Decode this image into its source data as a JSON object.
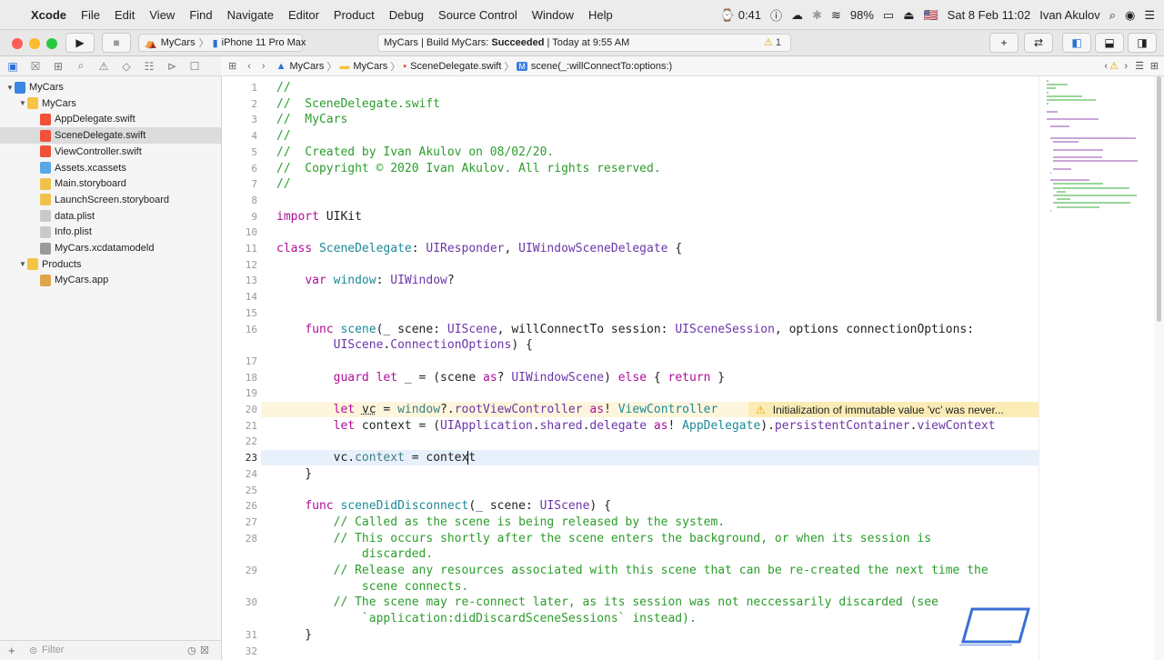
{
  "menubar": {
    "apple": "",
    "app_name": "Xcode",
    "items": [
      "File",
      "Edit",
      "View",
      "Find",
      "Navigate",
      "Editor",
      "Product",
      "Debug",
      "Source Control",
      "Window",
      "Help"
    ],
    "right": {
      "battery_time": "0:41",
      "battery_pct": "98%",
      "flag": "🇺🇸",
      "datetime": "Sat 8 Feb  11:02",
      "user": "Ivan Akulov"
    }
  },
  "toolbar": {
    "scheme": "MyCars",
    "device": "iPhone 11 Pro Max",
    "status_project": "MyCars | Build MyCars: ",
    "status_result": "Succeeded",
    "status_time": " | Today at 9:55 AM",
    "warning_count": "1"
  },
  "sidebar": {
    "items": [
      {
        "label": "MyCars",
        "indent": 0,
        "tri": "▼",
        "icon": "project",
        "color": "#3b86e0"
      },
      {
        "label": "MyCars",
        "indent": 1,
        "tri": "▼",
        "icon": "folder",
        "color": "#f6c343"
      },
      {
        "label": "AppDelegate.swift",
        "indent": 2,
        "tri": "",
        "icon": "swift",
        "color": "#f05138"
      },
      {
        "label": "SceneDelegate.swift",
        "indent": 2,
        "tri": "",
        "icon": "swift",
        "color": "#f05138",
        "selected": true
      },
      {
        "label": "ViewController.swift",
        "indent": 2,
        "tri": "",
        "icon": "swift",
        "color": "#f05138"
      },
      {
        "label": "Assets.xcassets",
        "indent": 2,
        "tri": "",
        "icon": "assets",
        "color": "#5aa7e8"
      },
      {
        "label": "Main.storyboard",
        "indent": 2,
        "tri": "",
        "icon": "storyboard",
        "color": "#f1c24b"
      },
      {
        "label": "LaunchScreen.storyboard",
        "indent": 2,
        "tri": "",
        "icon": "storyboard",
        "color": "#f1c24b"
      },
      {
        "label": "data.plist",
        "indent": 2,
        "tri": "",
        "icon": "plist",
        "color": "#c9c9c9"
      },
      {
        "label": "Info.plist",
        "indent": 2,
        "tri": "",
        "icon": "plist",
        "color": "#c9c9c9"
      },
      {
        "label": "MyCars.xcdatamodeld",
        "indent": 2,
        "tri": "",
        "icon": "datamodel",
        "color": "#9a9a9a"
      },
      {
        "label": "Products",
        "indent": 1,
        "tri": "▼",
        "icon": "folder",
        "color": "#f6c343"
      },
      {
        "label": "MyCars.app",
        "indent": 2,
        "tri": "",
        "icon": "app",
        "color": "#e0a44a"
      }
    ],
    "filter_placeholder": "Filter"
  },
  "jumpbar": {
    "crumbs": [
      "MyCars",
      "MyCars",
      "SceneDelegate.swift",
      "scene(_:willConnectTo:options:)"
    ]
  },
  "editor": {
    "current_line": 23,
    "warning_text": "Initialization of immutable value 'vc' was never..."
  },
  "code": [
    {
      "n": "1",
      "html": "<span class='c'>//</span>"
    },
    {
      "n": "2",
      "html": "<span class='c'>//  SceneDelegate.swift</span>"
    },
    {
      "n": "3",
      "html": "<span class='c'>//  MyCars</span>"
    },
    {
      "n": "4",
      "html": "<span class='c'>//</span>"
    },
    {
      "n": "5",
      "html": "<span class='c'>//  Created by Ivan Akulov on 08/02/20.</span>"
    },
    {
      "n": "6",
      "html": "<span class='c'>//  Copyright © 2020 Ivan Akulov. All rights reserved.</span>"
    },
    {
      "n": "7",
      "html": "<span class='c'>//</span>"
    },
    {
      "n": "8",
      "html": ""
    },
    {
      "n": "9",
      "html": "<span class='k'>import</span> UIKit"
    },
    {
      "n": "10",
      "html": ""
    },
    {
      "n": "11",
      "html": "<span class='k'>class</span> <span class='t'>SceneDelegate</span>: <span class='p'>UIResponder</span>, <span class='p'>UIWindowSceneDelegate</span> {"
    },
    {
      "n": "12",
      "html": ""
    },
    {
      "n": "13",
      "html": "    <span class='k'>var</span> <span class='t'>window</span>: <span class='p'>UIWindow</span>?"
    },
    {
      "n": "14",
      "html": ""
    },
    {
      "n": "15",
      "html": ""
    },
    {
      "n": "16",
      "html": "    <span class='k'>func</span> <span class='t'>scene</span>(_ scene: <span class='p'>UIScene</span>, willConnectTo session: <span class='p'>UISceneSession</span>, options connectionOptions:"
    },
    {
      "n": "",
      "html": "        <span class='p'>UIScene</span>.<span class='p'>ConnectionOptions</span>) {"
    },
    {
      "n": "17",
      "html": ""
    },
    {
      "n": "18",
      "html": "        <span class='k'>guard</span> <span class='k'>let</span> _ = (scene <span class='k'>as</span>? <span class='p'>UIWindowScene</span>) <span class='k'>else</span> { <span class='k'>return</span> }"
    },
    {
      "n": "19",
      "html": ""
    },
    {
      "n": "20",
      "html": "        <span class='k'>let</span> <span style='text-decoration:underline dotted'>vc</span> = <span class='pm'>window</span>?.<span class='p'>rootViewController</span> <span class='k'>as</span>! <span class='t'>ViewController</span>"
    },
    {
      "n": "21",
      "html": "        <span class='k'>let</span> context = (<span class='p'>UIApplication</span>.<span class='p'>shared</span>.<span class='p'>delegate</span> <span class='k'>as</span>! <span class='t'>AppDelegate</span>).<span class='p'>persistentContainer</span>.<span class='p'>viewContext</span>"
    },
    {
      "n": "22",
      "html": ""
    },
    {
      "n": "23",
      "html": "        vc.<span class='pm'>context</span> = contex<span style='border-left:1px solid #000;margin-left:-1px'></span>t"
    },
    {
      "n": "24",
      "html": "    }"
    },
    {
      "n": "25",
      "html": ""
    },
    {
      "n": "26",
      "html": "    <span class='k'>func</span> <span class='t'>sceneDidDisconnect</span>(_ scene: <span class='p'>UIScene</span>) {"
    },
    {
      "n": "27",
      "html": "        <span class='c'>// Called as the scene is being released by the system.</span>"
    },
    {
      "n": "28",
      "html": "        <span class='c'>// This occurs shortly after the scene enters the background, or when its session is</span>"
    },
    {
      "n": "",
      "html": "            <span class='c'>discarded.</span>"
    },
    {
      "n": "29",
      "html": "        <span class='c'>// Release any resources associated with this scene that can be re-created the next time the</span>"
    },
    {
      "n": "",
      "html": "            <span class='c'>scene connects.</span>"
    },
    {
      "n": "30",
      "html": "        <span class='c'>// The scene may re-connect later, as its session was not neccessarily discarded (see</span>"
    },
    {
      "n": "",
      "html": "            <span class='c'>`application:didDiscardSceneSessions` instead).</span>"
    },
    {
      "n": "31",
      "html": "    }"
    },
    {
      "n": "32",
      "html": ""
    }
  ],
  "colors": {
    "accent": "#2b6fd6",
    "warning_bg": "#fbecb6",
    "current_line": "#e8f0fb"
  }
}
